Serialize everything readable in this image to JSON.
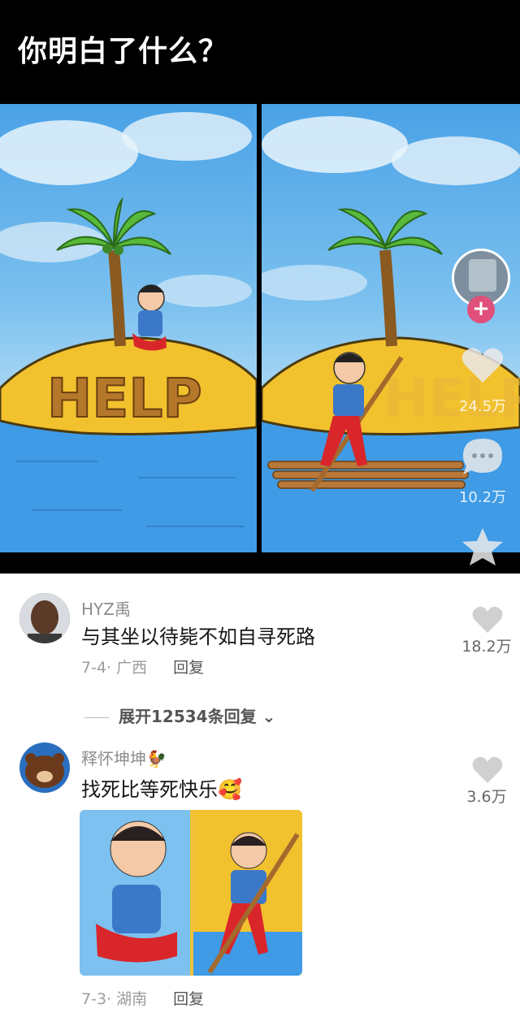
{
  "video": {
    "title": "你明白了什么？",
    "left_panel_text": "HELP",
    "right_panel_text": "HELP",
    "likes": "24.5万",
    "comments": "10.2万",
    "follow_symbol": "+"
  },
  "comments": [
    {
      "user": "HYZ禹",
      "text": "与其坐以待毙不如自寻死路",
      "meta": "7-4· 广西",
      "reply_label": "回复",
      "likes": "18.2万"
    },
    {
      "user": "释怀坤坤🐓",
      "text": "找死比等死快乐🥰",
      "meta": "7-3· 湖南",
      "reply_label": "回复",
      "likes": "3.6万"
    }
  ],
  "expand_replies": "展开12534条回复",
  "colors": {
    "sky": "#5aaee9",
    "sea": "#3f9be6",
    "island": "#f2c12e",
    "text_dark": "#161616",
    "text_gray": "#8d8d8d"
  }
}
